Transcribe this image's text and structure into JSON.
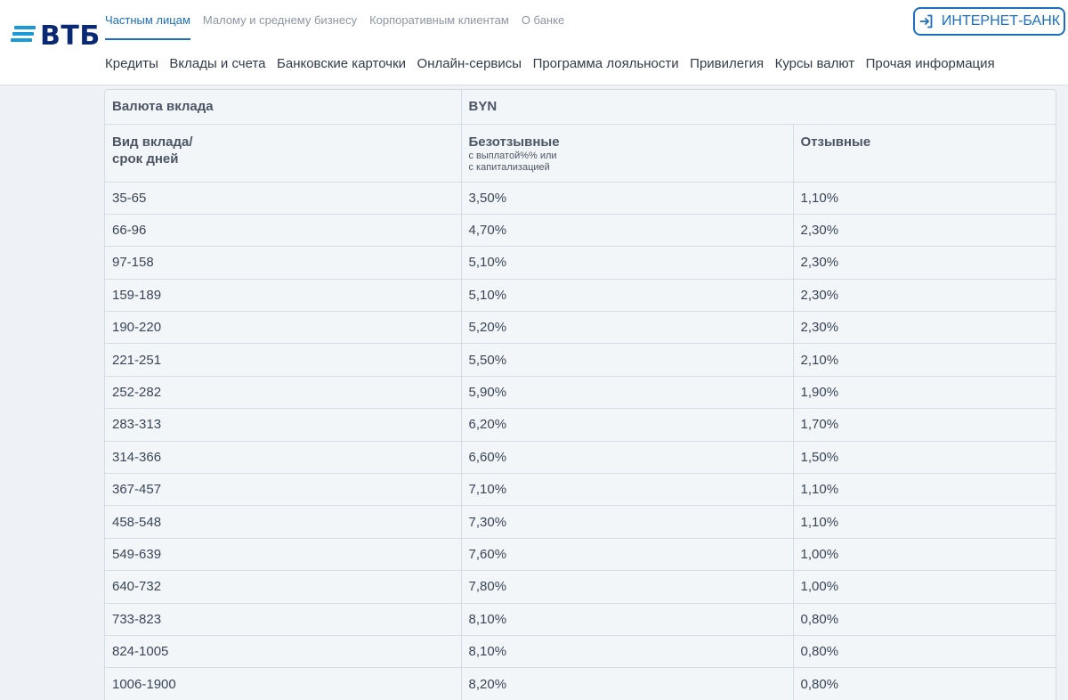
{
  "logo": {
    "text": "ВТБ",
    "color": "#0a2973",
    "stripe_color": "#1a9ad6"
  },
  "top_nav": [
    {
      "label": "Частным лицам",
      "active": true
    },
    {
      "label": "Малому и среднему бизнесу",
      "active": false
    },
    {
      "label": "Корпоративным клиентам",
      "active": false
    },
    {
      "label": "О банке",
      "active": false
    }
  ],
  "internet_bank": {
    "label": "ИНТЕРНЕТ-БАНК",
    "icon": "login-icon",
    "color": "#1a6fc0"
  },
  "sub_nav": [
    "Кредиты",
    "Вклады и счета",
    "Банковские карточки",
    "Онлайн-сервисы",
    "Программа лояльности",
    "Привилегия",
    "Курсы валют",
    "Прочая информация"
  ],
  "table": {
    "currency_label": "Валюта вклада",
    "currency_value": "BYN",
    "type_label_line1": "Вид вклада/",
    "type_label_line2": "срок дней",
    "col_irrevocable": "Безотзывные",
    "col_irrevocable_note_line1": "с выплатой%% или",
    "col_irrevocable_note_line2": "с капитализацией",
    "col_revocable": "Отзывные",
    "rows": [
      [
        "35-65",
        "3,50%",
        "1,10%"
      ],
      [
        "66-96",
        "4,70%",
        "2,30%"
      ],
      [
        "97-158",
        "5,10%",
        "2,30%"
      ],
      [
        "159-189",
        "5,10%",
        "2,30%"
      ],
      [
        "190-220",
        "5,20%",
        "2,30%"
      ],
      [
        "221-251",
        "5,50%",
        "2,10%"
      ],
      [
        "252-282",
        "5,90%",
        "1,90%"
      ],
      [
        "283-313",
        "6,20%",
        "1,70%"
      ],
      [
        "314-366",
        "6,60%",
        "1,50%"
      ],
      [
        "367-457",
        "7,10%",
        "1,10%"
      ],
      [
        "458-548",
        "7,30%",
        "1,10%"
      ],
      [
        "549-639",
        "7,60%",
        "1,00%"
      ],
      [
        "640-732",
        "7,80%",
        "1,00%"
      ],
      [
        "733-823",
        "8,10%",
        "0,80%"
      ],
      [
        "824-1005",
        "8,10%",
        "0,80%"
      ],
      [
        "1006-1900",
        "8,20%",
        "0,80%"
      ]
    ]
  }
}
